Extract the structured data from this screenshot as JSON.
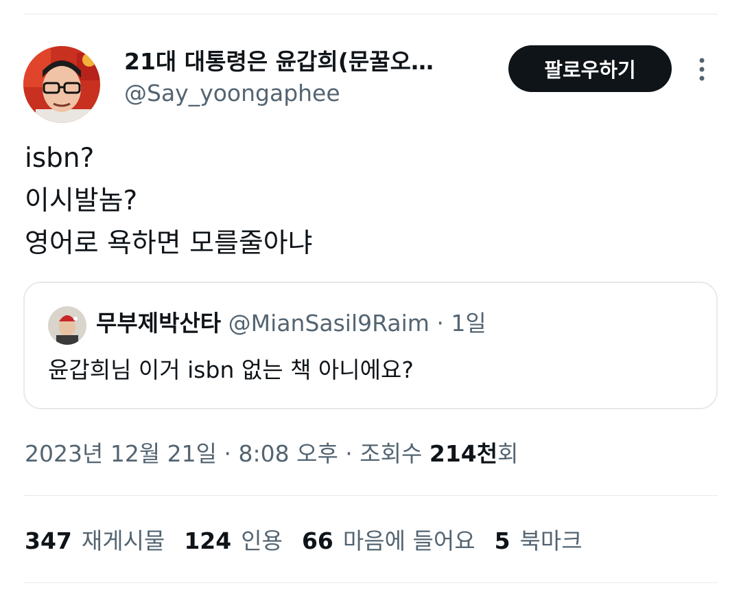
{
  "author": {
    "display_name": "21대 대통령은 윤갑희(문꿀오…",
    "handle": "@Say_yoongaphee"
  },
  "follow_button": {
    "label": "팔로우하기"
  },
  "more_icon": "more-vertical-icon",
  "tweet": {
    "lines": [
      "isbn?",
      "이시발놈?",
      "영어로 욕하면 모를줄아냐"
    ]
  },
  "quote": {
    "display_name": "무부제박산타",
    "handle": "@MianSasil9Raim",
    "separator": " · ",
    "time": "1일",
    "text": "윤갑희님 이거 isbn 없는 책 아니에요?"
  },
  "meta": {
    "timestamp": "2023년 12월 21일 · 8:08 오후 · 조회수 ",
    "views_count": "214천",
    "views_suffix": "회"
  },
  "stats": [
    {
      "count": "347",
      "label": "재게시물"
    },
    {
      "count": "124",
      "label": "인용"
    },
    {
      "count": "66",
      "label": "마음에 들어요"
    },
    {
      "count": "5",
      "label": "북마크"
    }
  ],
  "colors": {
    "text_primary": "#0f1419",
    "text_secondary": "#536471",
    "divider": "#e6e9ec",
    "button_bg": "#0f1419",
    "button_text": "#ffffff"
  }
}
